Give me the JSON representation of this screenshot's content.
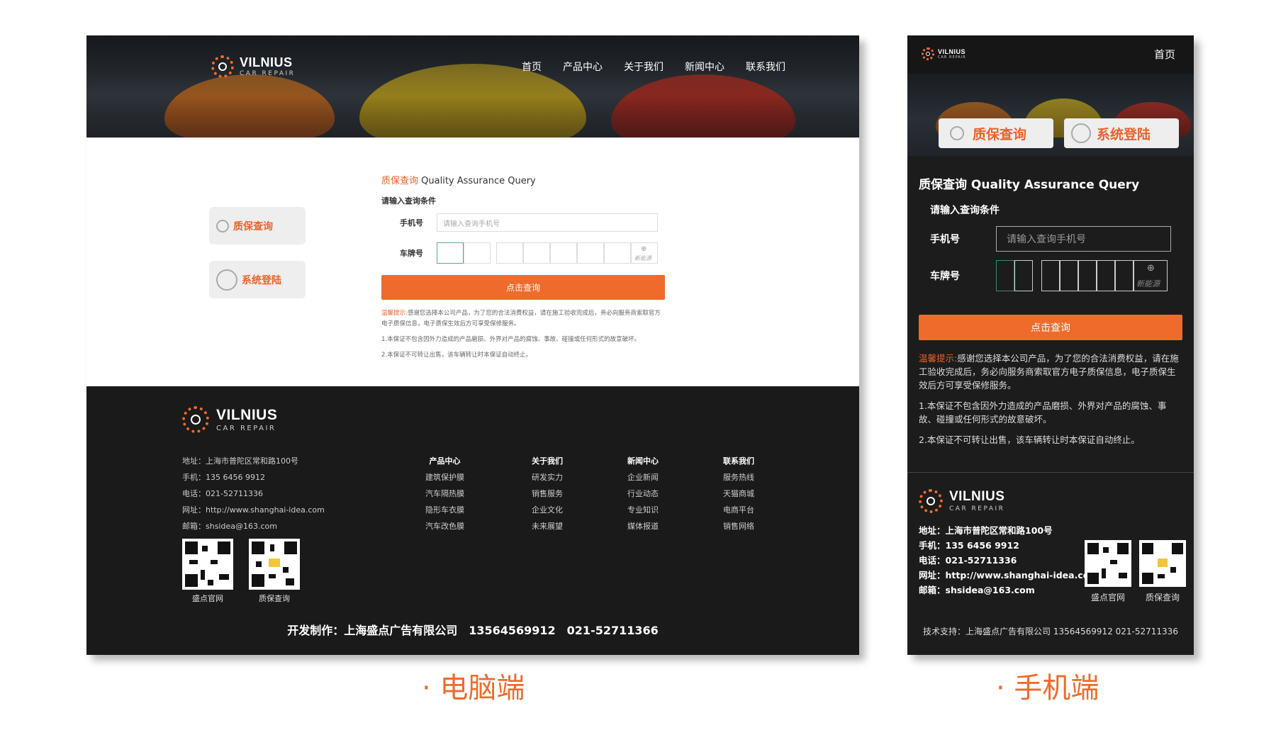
{
  "brand": {
    "name": "VILNIUS",
    "tagline": "CAR REPAIR"
  },
  "nav": [
    "首页",
    "产品中心",
    "关于我们",
    "新闻中心",
    "联系我们"
  ],
  "side": {
    "warranty": "质保查询",
    "login": "系统登陆"
  },
  "query": {
    "title_cn": "质保查询",
    "title_en": "Quality Assurance Query",
    "subtitle": "请输入查询条件",
    "phone_label": "手机号",
    "phone_placeholder": "请输入查询手机号",
    "plate_label": "车牌号",
    "new_energy": "新能源",
    "button": "点击查询",
    "notice_label": "温馨提示:",
    "notice_text": "感谢您选择本公司产品，为了您的合法消费权益，请在施工验收完成后，务必向服务商索取官方电子质保信息，电子质保生效后方可享受保修服务。",
    "rule1": "1.本保证不包含因外力造成的产品磨损、外界对产品的腐蚀、事故、碰撞或任何形式的故意破坏。",
    "rule2": "2.本保证不可转让出售，该车辆转让时本保证自动终止。"
  },
  "contact": {
    "address": "地址：上海市普陀区常和路100号",
    "mobile": "手机：135 6456 9912",
    "tel": "电话：021-52711336",
    "web": "网址：http://www.shanghai-idea.com",
    "email": "邮箱：shsidea@163.com"
  },
  "footer_cols": [
    {
      "h": "产品中心",
      "items": [
        "建筑保护膜",
        "汽车隔热膜",
        "隐形车衣膜",
        "汽车改色膜"
      ]
    },
    {
      "h": "关于我们",
      "items": [
        "研发实力",
        "销售服务",
        "企业文化",
        "未来展望"
      ]
    },
    {
      "h": "新闻中心",
      "items": [
        "企业新闻",
        "行业动态",
        "专业知识",
        "媒体报道"
      ]
    },
    {
      "h": "联系我们",
      "items": [
        "服务热线",
        "天猫商城",
        "电商平台",
        "销售网络"
      ]
    }
  ],
  "qr": [
    "盛点官网",
    "质保查询"
  ],
  "dev_credit": "开发制作：上海盛点广告有限公司　13564569912　021-52711366",
  "mobile": {
    "nav_home": "首页",
    "contact": {
      "address": "地址：上海市普陀区常和路100号",
      "mobile": "手机：135 6456 9912",
      "tel": "电话：021-52711336",
      "web": "网址：http://www.shanghai-idea.com",
      "email": "邮箱：shsidea@163.com"
    },
    "tech_support": "技术支持：上海盛点广告有限公司  13564569912  021-52711336"
  },
  "captions": {
    "desktop": "· 电脑端",
    "mobile": "· 手机端"
  },
  "colors": {
    "accent": "#ef6b2c",
    "dark": "#1a1a1a",
    "panel": "#eeeeee"
  }
}
